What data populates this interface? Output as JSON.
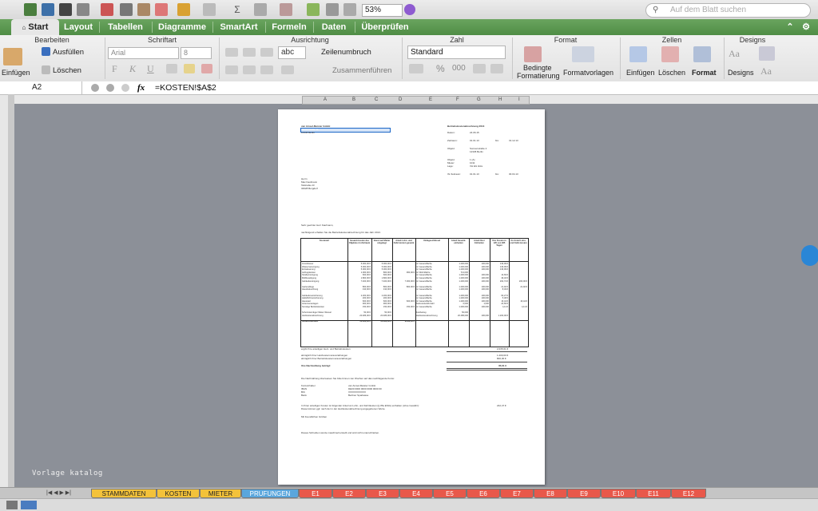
{
  "toolbar": {
    "zoom_value": "53%",
    "search_placeholder": "Auf dem Blatt suchen"
  },
  "tabs": [
    {
      "label": "Start",
      "active": true
    },
    {
      "label": "Layout"
    },
    {
      "label": "Tabellen"
    },
    {
      "label": "Diagramme"
    },
    {
      "label": "SmartArt"
    },
    {
      "label": "Formeln"
    },
    {
      "label": "Daten"
    },
    {
      "label": "Überprüfen"
    }
  ],
  "ribbon": {
    "groups": [
      "Bearbeiten",
      "Schriftart",
      "Ausrichtung",
      "Zahl",
      "Format",
      "Zellen",
      "Designs"
    ],
    "fill_label": "Ausfüllen",
    "clear_label": "Löschen",
    "paste_label": "Einfügen",
    "font_name": "Arial",
    "font_size": "8",
    "bold": "F",
    "italic": "K",
    "underline": "U",
    "wrap_sample": "abc",
    "wrap_label": "Zeilenumbruch",
    "merge_label": "Zusammenführen",
    "number_format": "Standard",
    "percent": "%",
    "thousands": "000",
    "cond_format_label_1": "Bedingte",
    "cond_format_label_2": "Formatierung",
    "format_templates_label": "Formatvorlagen",
    "insert_label": "Einfügen",
    "delete_label": "Löschen",
    "format_label": "Format",
    "designs_label": "Designs",
    "designs_sample": "Aa"
  },
  "formula_bar": {
    "cell_ref": "A2",
    "fx": "fx",
    "formula": "=KOSTEN!$A$2"
  },
  "columns": [
    "A",
    "B",
    "C",
    "D",
    "E",
    "F",
    "G",
    "H",
    "I"
  ],
  "document": {
    "sender": "van Amsel-Meister GmbH",
    "sender_street": "Musterstraße 11",
    "sender_city": "12345 Berlin",
    "title": "Betriebskostenabrechnung 2013",
    "date_label": "Datum:",
    "date": "24.06.15",
    "period_label": "Zeitraum:",
    "period_from": "01.01.13",
    "period_to_label": "bis:",
    "period_to": "31.12.13",
    "object_label": "Objekt:",
    "object_street": "Sonnenstraße 2",
    "object_city": "12345 Berlin",
    "rows_meta": [
      [
        "Objekt:",
        "1 (A)"
      ],
      [
        "Mieter:",
        "1011"
      ],
      [
        "Lage:",
        "VH EG links"
      ]
    ],
    "tenant_period_label": "Ihr Zeitraum:",
    "tenant_period_from": "01.01.13",
    "tenant_period_to": "30.04.13",
    "recipient": [
      "Herrn",
      "Max Kaufmann",
      "Talstraße 23",
      "34628 Bergdorf"
    ],
    "salutation": "Sehr geehrter Herr Kaufmann,",
    "intro": "nachfolgend erhalten Sie die Betriebskostenabrechnung für das Jahr 2013.",
    "table_headers": [
      "Kostenart",
      "Gesamt-kosten des Objektes im Zeitraum",
      "davon auf Mieter umgelegt",
      "Anteil Lohn- und Fahrt-kosten gesamt",
      "Umlageschlüssel",
      "Anteil Gesamt-einheiten",
      "Anteil Ihrer Einheiten",
      "Ihre Kosten in 120 von 365 Tagen",
      "Ihr Anteil Lohn- und Fahrt-kosten"
    ],
    "cost_rows": [
      [
        "Grundsteuer",
        "5.000,00 €",
        "5.000,00 €",
        "",
        "m² Gesamtfläche",
        "1.200,000",
        "100,000",
        "136,99 €",
        ""
      ],
      [
        "Wasserversorgung",
        "5.000,00 €",
        "5.000,00 €",
        "",
        "m² Gesamtfläche",
        "1.200,000",
        "100,000",
        "136,99 €",
        ""
      ],
      [
        "Entwässerung",
        "5.000,00 €",
        "5.000,00 €",
        "",
        "m² Gesamtfläche",
        "1.200,000",
        "100,000",
        "136,99 €",
        ""
      ],
      [
        "Aufzugskosten",
        "1.000,00 €",
        "800,00 €",
        "960,00 €",
        "m² Wohnfläche",
        "713,000",
        "",
        "",
        ""
      ],
      [
        "Straßenreinigung",
        "600,00 €",
        "600,00 €",
        "",
        "m² Gesamtfläche",
        "1.200,000",
        "100,000",
        "13,69 €",
        ""
      ],
      [
        "Müllbeseitigung",
        "1.800,00 €",
        "1.800,00 €",
        "",
        "m² Gesamtfläche",
        "1.200,000",
        "100,000",
        "49,32 €",
        ""
      ],
      [
        "Gebäudereinigung",
        "7.400,00 €",
        "7.400,00 €",
        "7.300,00 €",
        "m² Gesamtfläche",
        "1.200,000",
        "100,000",
        "202,74 €",
        "200,00 €"
      ],
      [
        "Gartenpflege",
        "800,00 €",
        "800,00 €",
        "800,00 €",
        "m² Gesamtfläche",
        "1.200,000",
        "100,000",
        "21,92 €",
        "21,92 €"
      ],
      [
        "Hausbeleuchtung",
        "310,00 €",
        "310,00 €",
        "",
        "m² Gesamtfläche",
        "1.200,000",
        "100,000",
        "8,49 €",
        ""
      ],
      [
        "Gebäudeversicherung",
        "2.200,00 €",
        "2.200,00 €",
        "",
        "m² Gesamtfläche",
        "1.200,000",
        "100,000",
        "60,27 €",
        ""
      ],
      [
        "Haftpflichtversicherung",
        "200,00 €",
        "200,00 €",
        "",
        "m² Gesamtfläche",
        "1.200,000",
        "100,000",
        "5,48 €",
        ""
      ],
      [
        "Hauswart",
        "600,00 €",
        "600,00 €",
        "600,00 €",
        "m² Gesamtfläche",
        "1.200,000",
        "100,000",
        "16,44 €",
        "16,44 €"
      ],
      [
        "Antennenanlagen",
        "900,00 €",
        "900,00 €",
        "",
        "Nutzeranteil/Anzahl",
        "6,000",
        "1,000",
        "24,66 €",
        ""
      ],
      [
        "Sonstige Betriebskosten",
        "150,00 €",
        "150,00 €",
        "150,00 €",
        "m² Gesamtfläche",
        "1.200,000",
        "100,000",
        "4,11 €",
        "4,11 €"
      ],
      [
        "Schornsteinfeger Mieter Wessel",
        "50,00 €",
        "50,00 €",
        "",
        "Festbetrag",
        "50,000",
        "",
        "",
        ""
      ],
      [
        "Heizkostenabrechnung",
        "20.486,00 €",
        "20.486,00 €",
        "",
        "Heizkostenabrechnung",
        "20.486,000",
        "100,000",
        "1.200,00 €",
        ""
      ],
      [
        "Gesamtsummen",
        "52.666,00 €",
        "52.666,00 €",
        "9.810,00 €",
        "",
        "",
        "",
        "",
        ""
      ]
    ],
    "sum_lines": [
      [
        "ergibt Ihre anteiligen Heiz- und Betriebskosten",
        "2.035,61 €"
      ],
      [
        "abzüglich Ihrer Heizkostenvorauszahlungen",
        "1.200,00 €"
      ],
      [
        "abzüglich Ihrer Betriebskostenvorauszahlungen",
        "800,00 €"
      ]
    ],
    "result_label": "Ihre Nachzahlung beträgt:",
    "result_value": "35,61 €",
    "transfer_note": "Die Nachzahlung überweisen Sie bitte binnen vier Wochen auf das nachfolgende Konto:",
    "bank": [
      [
        "Kontoinhaber",
        "van Amsel-Meister GmbH"
      ],
      [
        "IBAN",
        "DE00 0000 0000 0000 0000 00"
      ],
      [
        "BIC",
        "XXXXXXXXXXX"
      ],
      [
        "Bank",
        "Berliner Sparkasse"
      ]
    ],
    "tax_note": "In Ihren anteiligen Kosten ist folgender Anteil an Lohn- und Fahrtkosten (§ 35a EStG) enthalten (ohne Gewähr):",
    "tax_value": "242,47 €",
    "tax_note_2": "Diese können ggf. nach der in der Heizkostenabrechnung angegebenen Werte.",
    "greeting": "Mit freundlichen Grüßen",
    "footer": "Dieses Schreiben wurde maschinell erstellt und wird nicht unterschrieben."
  },
  "watermark": "Vorlage katalog",
  "sheets": [
    "STAMMDATEN",
    "KOSTEN",
    "MIETER",
    "PRUFUNGEN",
    "E1",
    "E2",
    "E3",
    "E4",
    "E5",
    "E6",
    "E7",
    "E8",
    "E9",
    "E10",
    "E11",
    "E12"
  ]
}
